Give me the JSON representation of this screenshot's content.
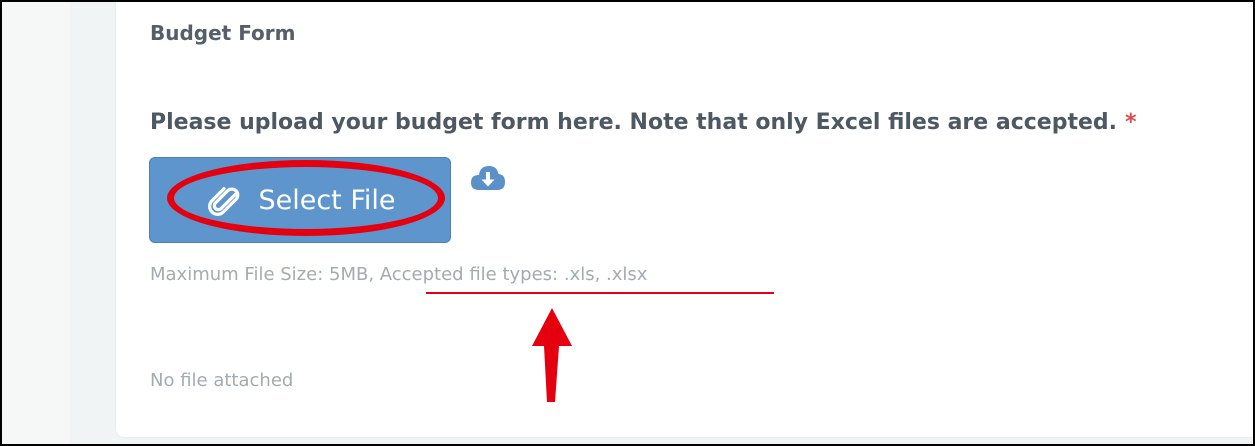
{
  "form": {
    "section_title": "Budget Form",
    "upload_label": "Please upload your budget form here. Note that only Excel files are accepted.",
    "required_marker": "*",
    "select_file_label": "Select File",
    "constraints_text": "Maximum File Size: 5MB, Accepted file types: .xls, .xlsx",
    "attachment_status": "No file attached"
  },
  "icons": {
    "select_button_icon": "paperclip-icon",
    "download_icon": "cloud-download-icon"
  },
  "colors": {
    "button_bg": "#5f95cd",
    "annotation_red": "#e4000f",
    "required_red": "#e04a4a",
    "label_text": "#4e5863",
    "muted_text": "#a3abb2"
  }
}
